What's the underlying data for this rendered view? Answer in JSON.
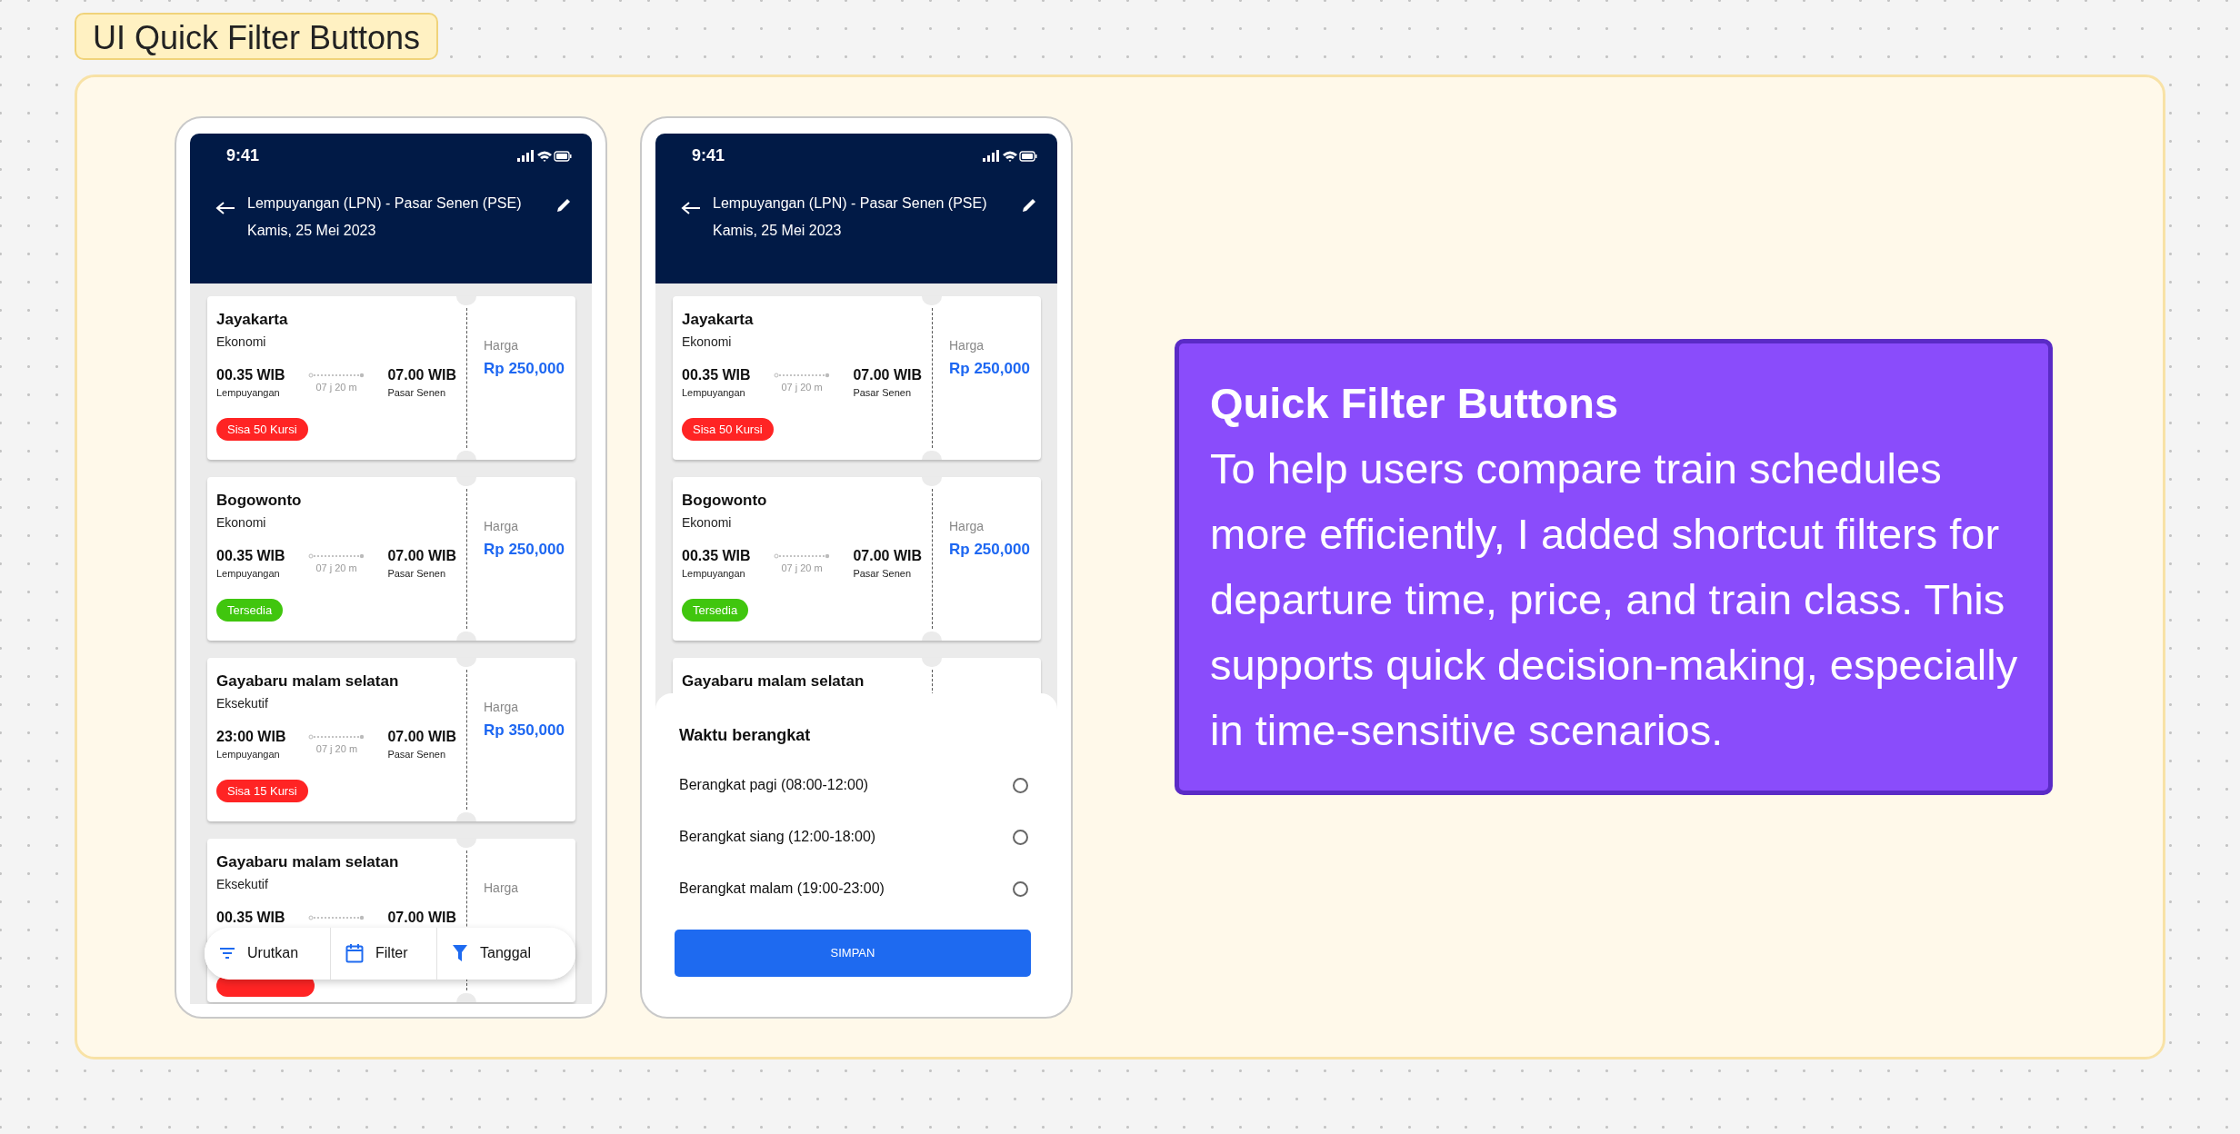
{
  "frame_label": "UI Quick Filter Buttons",
  "phones": [
    {
      "status_time": "9:41",
      "route": "Lempuyangan (LPN) - Pasar Senen (PSE)",
      "date": "Kamis, 25 Mei 2023",
      "trains": [
        {
          "name": "Jayakarta",
          "class": "Ekonomi",
          "depart_time": "00.35 WIB",
          "depart_station": "Lempuyangan",
          "duration": "07 j 20 m",
          "arrive_time": "07.00 WIB",
          "arrive_station": "Pasar Senen",
          "price_label": "Harga",
          "price": "Rp 250,000",
          "badge": {
            "color": "#ff2424",
            "text": "Sisa 50 Kursi"
          }
        },
        {
          "name": "Bogowonto",
          "class": "Ekonomi",
          "depart_time": "00.35 WIB",
          "depart_station": "Lempuyangan",
          "duration": "07 j 20 m",
          "arrive_time": "07.00 WIB",
          "arrive_station": "Pasar Senen",
          "price_label": "Harga",
          "price": "Rp 250,000",
          "badge": {
            "color": "#40c60e",
            "text": "Tersedia"
          }
        },
        {
          "name": "Gayabaru malam selatan",
          "class": "Eksekutif",
          "depart_time": "23:00 WIB",
          "depart_station": "Lempuyangan",
          "duration": "07 j 20 m",
          "arrive_time": "07.00 WIB",
          "arrive_station": "Pasar Senen",
          "price_label": "Harga",
          "price": "Rp 350,000",
          "badge": {
            "color": "#ff2424",
            "text": "Sisa 15 Kursi"
          }
        },
        {
          "name": "Gayabaru malam selatan",
          "class": "Eksekutif",
          "depart_time": "00.35 WIB",
          "arrive_time": "07.00 WIB",
          "price_label": "Harga",
          "badge": {
            "color": "#ff2424"
          }
        }
      ],
      "filter_bar": [
        {
          "label": "Urutkan",
          "kind": "sort"
        },
        {
          "label": "Filter",
          "kind": "calendar"
        },
        {
          "label": "Tanggal",
          "kind": "funnel"
        }
      ]
    },
    {
      "status_time": "9:41",
      "route": "Lempuyangan (LPN) - Pasar Senen (PSE)",
      "date": "Kamis, 25 Mei 2023",
      "trains": [
        {
          "name": "Jayakarta",
          "class": "Ekonomi",
          "depart_time": "00.35 WIB",
          "depart_station": "Lempuyangan",
          "duration": "07 j 20 m",
          "arrive_time": "07.00 WIB",
          "arrive_station": "Pasar Senen",
          "price_label": "Harga",
          "price": "Rp 250,000",
          "badge": {
            "color": "#ff2424",
            "text": "Sisa 50 Kursi"
          }
        },
        {
          "name": "Bogowonto",
          "class": "Ekonomi",
          "depart_time": "00.35 WIB",
          "depart_station": "Lempuyangan",
          "duration": "07 j 20 m",
          "arrive_time": "07.00 WIB",
          "arrive_station": "Pasar Senen",
          "price_label": "Harga",
          "price": "Rp 250,000",
          "badge": {
            "color": "#40c60e",
            "text": "Tersedia"
          }
        },
        {
          "name": "Gayabaru malam selatan"
        }
      ],
      "sheet": {
        "title": "Waktu berangkat",
        "options": [
          {
            "label": "Berangkat pagi (08:00-12:00)",
            "selected": false
          },
          {
            "label": "Berangkat siang (12:00-18:00)",
            "selected": false
          },
          {
            "label": "Berangkat malam (19:00-23:00)",
            "selected": false
          }
        ],
        "button": "SIMPAN"
      }
    }
  ],
  "note": {
    "title": "Quick Filter Buttons",
    "body": "To help users compare train schedules more efficiently, I added shortcut filters for departure time, price, and train class. This supports quick decision-making, especially in time-sensitive scenarios."
  }
}
